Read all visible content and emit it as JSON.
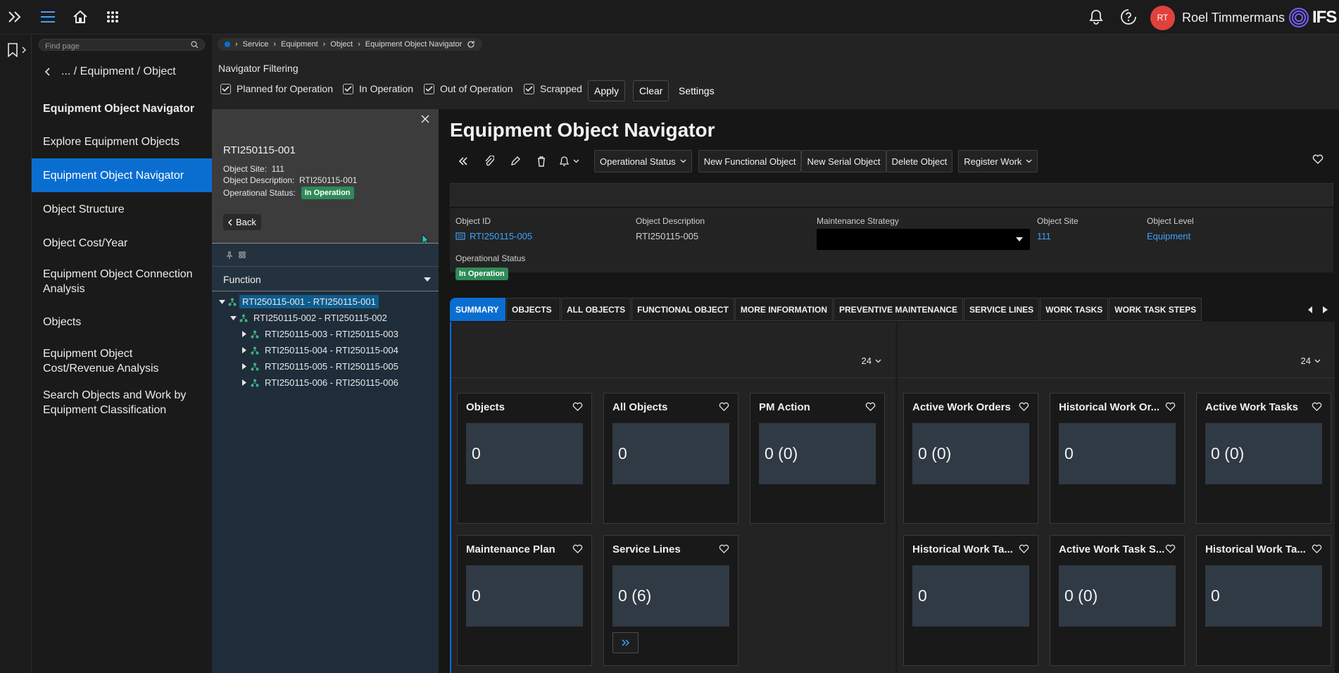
{
  "user": {
    "initials": "RT",
    "name": "Roel Timmermans"
  },
  "logo": {
    "text": "IFS"
  },
  "search": {
    "placeholder": "Find page"
  },
  "nav": {
    "back_label": "... / Equipment / Object",
    "items": [
      {
        "label": "Equipment Object Navigator",
        "bold": true
      },
      {
        "label": "Explore Equipment Objects"
      },
      {
        "label": "Equipment Object Navigator",
        "active": true
      },
      {
        "label": "Object Structure"
      },
      {
        "label": "Object Cost/Year"
      },
      {
        "label": "Equipment Object Connection Analysis"
      },
      {
        "label": "Objects"
      },
      {
        "label": "Equipment Object Cost/Revenue Analysis"
      },
      {
        "label": "Search Objects and Work by Equipment Classification"
      }
    ]
  },
  "breadcrumb": [
    "Service",
    "Equipment",
    "Object",
    "Equipment Object Navigator"
  ],
  "filter": {
    "title": "Navigator Filtering",
    "checks": [
      "Planned for Operation",
      "In Operation",
      "Out of Operation",
      "Scrapped"
    ],
    "apply": "Apply",
    "clear": "Clear",
    "settings": "Settings"
  },
  "detail": {
    "title": "RTI250115-001",
    "site_label": "Object Site:",
    "site_value": "111",
    "desc_label": "Object Description:",
    "desc_value": "RTI250115-001",
    "status_label": "Operational Status:",
    "status_value": "In Operation",
    "back": "Back",
    "function_label": "Function"
  },
  "tree": [
    {
      "label": "RTI250115-001 - RTI250115-001",
      "level": 0,
      "expanded": true,
      "selected": true
    },
    {
      "label": "RTI250115-002 - RTI250115-002",
      "level": 1,
      "expanded": true
    },
    {
      "label": "RTI250115-003 - RTI250115-003",
      "level": 2
    },
    {
      "label": "RTI250115-004 - RTI250115-004",
      "level": 2
    },
    {
      "label": "RTI250115-005 - RTI250115-005",
      "level": 2
    },
    {
      "label": "RTI250115-006 - RTI250115-006",
      "level": 2
    }
  ],
  "main": {
    "title": "Equipment Object Navigator",
    "commands": {
      "operational_status": "Operational Status",
      "new_functional": "New Functional Object",
      "new_serial": "New Serial Object",
      "delete": "Delete Object",
      "register_work": "Register Work"
    },
    "fields": {
      "object_id_label": "Object ID",
      "object_id_value": "RTI250115-005",
      "desc_label": "Object Description",
      "desc_value": "RTI250115-005",
      "strategy_label": "Maintenance Strategy",
      "site_label": "Object Site",
      "site_value": "111",
      "level_label": "Object Level",
      "level_value": "Equipment",
      "status_label": "Operational Status",
      "status_value": "In Operation"
    },
    "tabs": [
      "SUMMARY",
      "OBJECTS",
      "ALL OBJECTS",
      "FUNCTIONAL OBJECT",
      "MORE INFORMATION",
      "PREVENTIVE MAINTENANCE",
      "SERVICE LINES",
      "WORK TASKS",
      "WORK TASK STEPS"
    ],
    "pager_left": "24",
    "pager_right": "24",
    "tiles_left": [
      {
        "title": "Objects",
        "value": "0"
      },
      {
        "title": "All Objects",
        "value": "0"
      },
      {
        "title": "PM Action",
        "value": "0 (0)"
      },
      {
        "title": "Maintenance Plan",
        "value": "0"
      },
      {
        "title": "Service Lines",
        "value": "0 (6)"
      }
    ],
    "tiles_right": [
      {
        "title": "Active Work Orders",
        "value": "0 (0)"
      },
      {
        "title": "Historical Work Or...",
        "value": "0"
      },
      {
        "title": "Active Work Tasks",
        "value": "0 (0)"
      },
      {
        "title": "Historical Work Ta...",
        "value": "0"
      },
      {
        "title": "Active Work Task S...",
        "value": "0 (0)"
      },
      {
        "title": "Historical Work Ta...",
        "value": "0"
      }
    ]
  },
  "colors": {
    "accent": "#0a6ed1",
    "status_green": "#2e8b57",
    "link": "#3ca3ff",
    "avatar": "#e0413c"
  }
}
